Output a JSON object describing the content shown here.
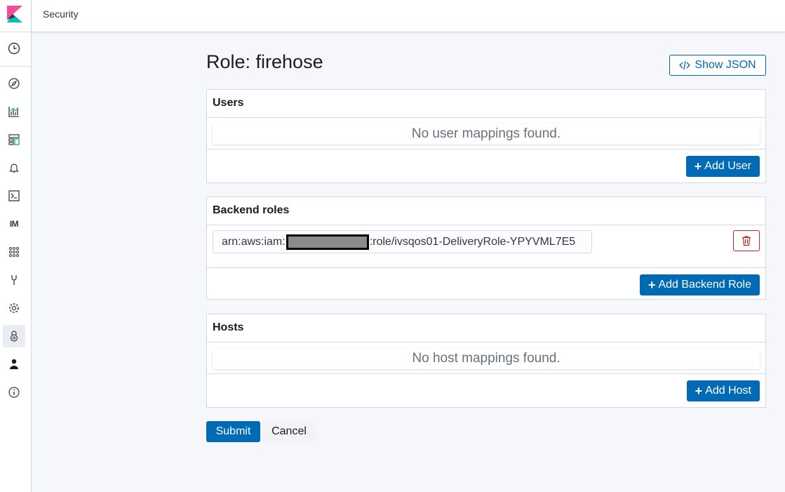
{
  "header": {
    "breadcrumb": "Security"
  },
  "sidebar": {
    "items": [
      {
        "icon": "clock-icon"
      },
      {
        "icon": "compass-icon"
      },
      {
        "icon": "visualize-icon"
      },
      {
        "icon": "dashboard-icon"
      },
      {
        "icon": "bell-icon"
      },
      {
        "icon": "console-icon"
      },
      {
        "icon": "im-text",
        "label": "IM"
      },
      {
        "icon": "grid-icon"
      },
      {
        "icon": "wrench-icon"
      },
      {
        "icon": "gear-icon"
      },
      {
        "icon": "security-lock-icon"
      },
      {
        "icon": "user-icon"
      },
      {
        "icon": "info-icon"
      }
    ]
  },
  "page": {
    "title": "Role: firehose",
    "show_json_label": "Show JSON"
  },
  "users": {
    "title": "Users",
    "empty_text": "No user mappings found.",
    "add_label": "Add User"
  },
  "backend_roles": {
    "title": "Backend roles",
    "value_prefix": "arn:aws:iam:",
    "value_suffix": ":role/ivsqos01-DeliveryRole-YPYVML7E5",
    "add_label": "Add Backend Role"
  },
  "hosts": {
    "title": "Hosts",
    "empty_text": "No host mappings found.",
    "add_label": "Add Host"
  },
  "actions": {
    "submit_label": "Submit",
    "cancel_label": "Cancel"
  },
  "colors": {
    "primary": "#006bb4",
    "danger": "#bd271e",
    "logo_pink": "#f04e98",
    "logo_teal": "#00bfb3"
  }
}
